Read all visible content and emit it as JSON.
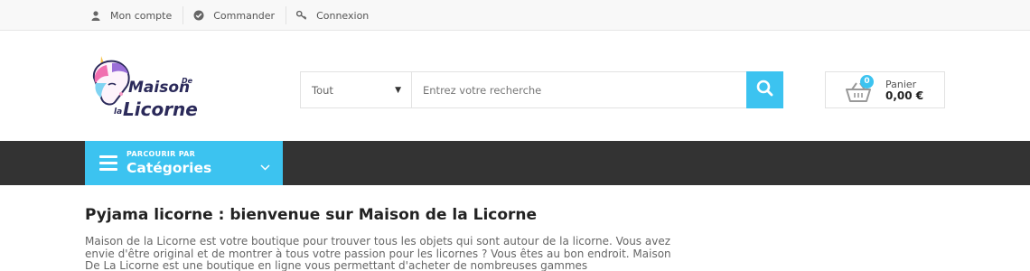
{
  "topbar": {
    "items": [
      {
        "label": "Mon compte",
        "icon": "user-icon"
      },
      {
        "label": "Commander",
        "icon": "check-circle-icon"
      },
      {
        "label": "Connexion",
        "icon": "key-icon"
      }
    ]
  },
  "logo": {
    "alt": "Maison De la Licorne",
    "line1": "Maison",
    "line1b": "De",
    "line2a": "la",
    "line2": "Licorne"
  },
  "search": {
    "category_selected": "Tout",
    "placeholder": "Entrez votre recherche",
    "value": ""
  },
  "cart": {
    "count": "0",
    "label": "Panier",
    "amount": "0,00 €"
  },
  "nav": {
    "categories_small": "PARCOURIR PAR",
    "categories_big": "Catégories"
  },
  "main": {
    "title": "Pyjama licorne : bienvenue sur Maison de la Licorne",
    "intro": "Maison de la Licorne est votre boutique pour trouver tous les objets qui sont autour de la licorne. Vous avez envie d'être original et de montrer à tous votre passion pour les licornes ? Vous êtes au bon endroit. Maison De La Licorne est une boutique en ligne vous permettant d'acheter de nombreuses gammes"
  },
  "colors": {
    "accent": "#3cc3f0",
    "navbar": "#333333",
    "topbar": "#f8f8f8"
  }
}
